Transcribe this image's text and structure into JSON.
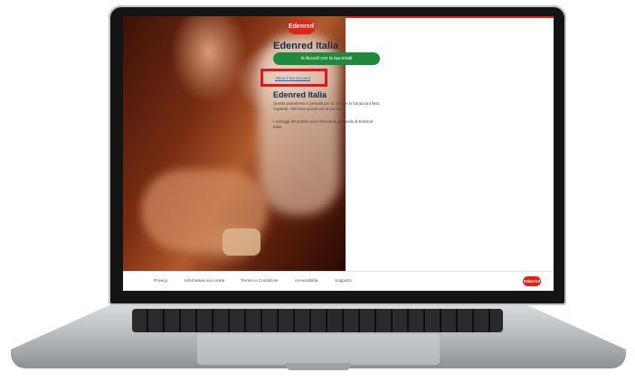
{
  "brand": {
    "logo_text": "Edenred",
    "accent": "#e2231a",
    "green": "#1f8a3c"
  },
  "login": {
    "title": "Edenred Italia",
    "email_button": "✉ Accedi con la tua email",
    "link": "Attiva il tuo account",
    "subtitle": "Edenred Italia",
    "para1": "Questa piattaforma è pensata per te. Se non lo hai ancora fatto, registrati. Altrimenti accedi con la tua mail.",
    "para2": "I vantaggi del portale sono riservati al personale di Edenred Italia."
  },
  "footer": {
    "links": [
      "Privacy",
      "Informativa sui cookie",
      "Termini e Condizioni",
      "Accessibilità",
      "Supporto"
    ]
  }
}
